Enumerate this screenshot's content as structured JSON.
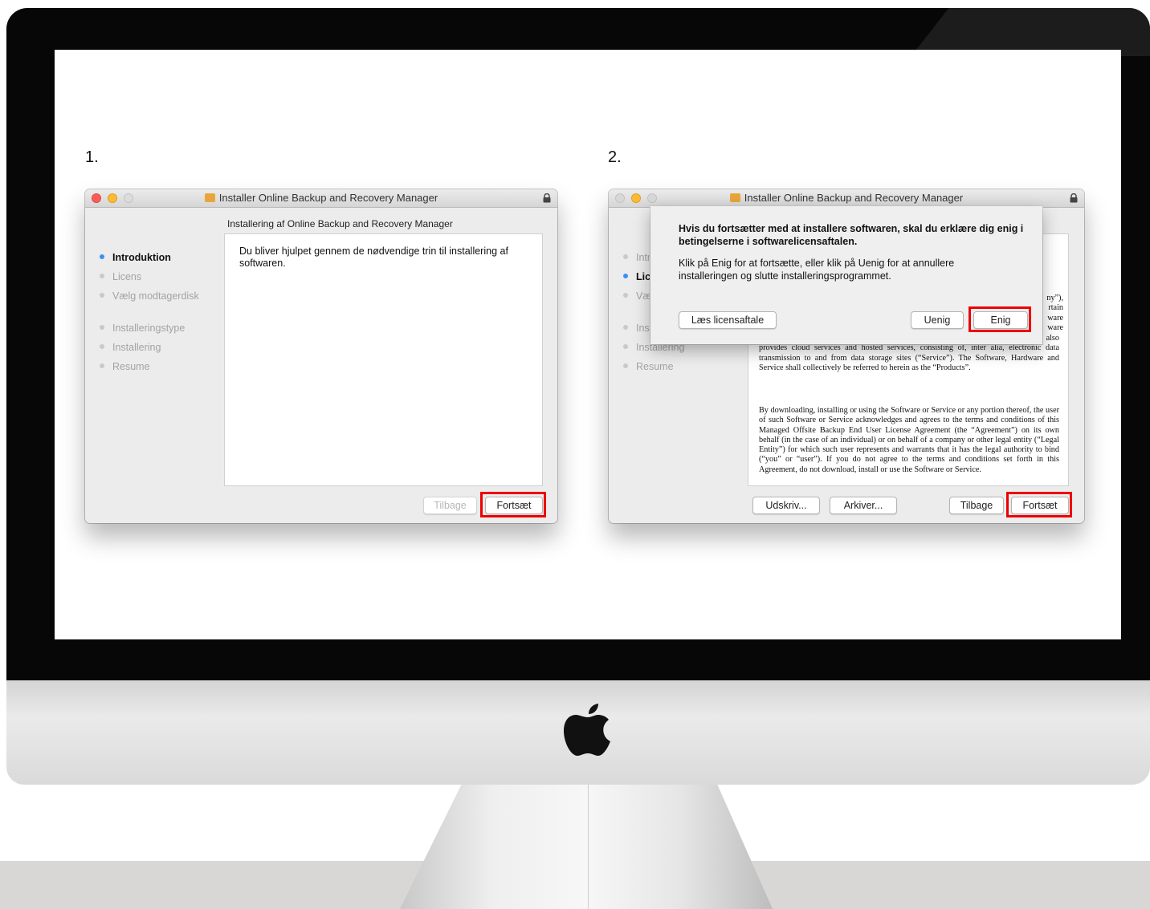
{
  "steps": {
    "first": "1.",
    "second": "2."
  },
  "window1": {
    "title": "Installer Online Backup and Recovery Manager",
    "subheading": "Installering af Online Backup and Recovery Manager",
    "nav": [
      "Introduktion",
      "Licens",
      "Vælg modtagerdisk",
      "Installeringstype",
      "Installering",
      "Resume"
    ],
    "active_nav": "Introduktion",
    "body_text": "Du bliver hjulpet gennem de nødvendige trin til installering af softwaren.",
    "back_button": "Tilbage",
    "continue_button": "Fortsæt"
  },
  "window2": {
    "title": "Installer Online Backup and Recovery Manager",
    "nav_partial": [
      "Intr",
      "Lic",
      "Væ",
      "Ins",
      "Installering",
      "Resume"
    ],
    "active_nav": "Lic",
    "license_fragments": [
      "ny”),",
      "rtain",
      "ware",
      "ware"
    ],
    "license_p1": "leased, sold or otherwise provided along with the Software (“Hardware”). Company also provides cloud services and hosted services, consisting of, inter alia, electronic data transmission to and from data storage sites (“Service”). The Software, Hardware and Service shall collectively be referred to herein as the “Products”.",
    "license_p2": "By downloading, installing or using the Software or Service or any portion thereof, the user of such Software or Service acknowledges and agrees to the terms and conditions of this Managed Offsite Backup End User License Agreement (the “Agreement”) on its own behalf (in the case of an individual) or on behalf of a company or other legal entity (“Legal Entity”) for which such user represents and warrants that it has the legal authority to bind (“you” or “user”). If you do not agree to the terms and conditions set forth in this Agreement, do not download, install or use the Software or Service.",
    "print_button": "Udskriv...",
    "save_button": "Arkiver...",
    "back_button": "Tilbage",
    "continue_button": "Fortsæt",
    "dialog": {
      "heading": "Hvis du fortsætter med at installere softwaren, skal du erklære dig enig i betingelserne i softwarelicensaftalen.",
      "message": "Klik på Enig for at fortsætte, eller klik på Uenig for at annullere installeringen og slutte installeringsprogrammet.",
      "read_license_button": "Læs licensaftale",
      "disagree_button": "Uenig",
      "agree_button": "Enig"
    }
  },
  "colors": {
    "highlight": "#ef0000",
    "active_dot": "#3a8ff5",
    "bezel": "#070707"
  },
  "icons": [
    "installer-package-icon",
    "lock-icon",
    "apple-logo"
  ]
}
